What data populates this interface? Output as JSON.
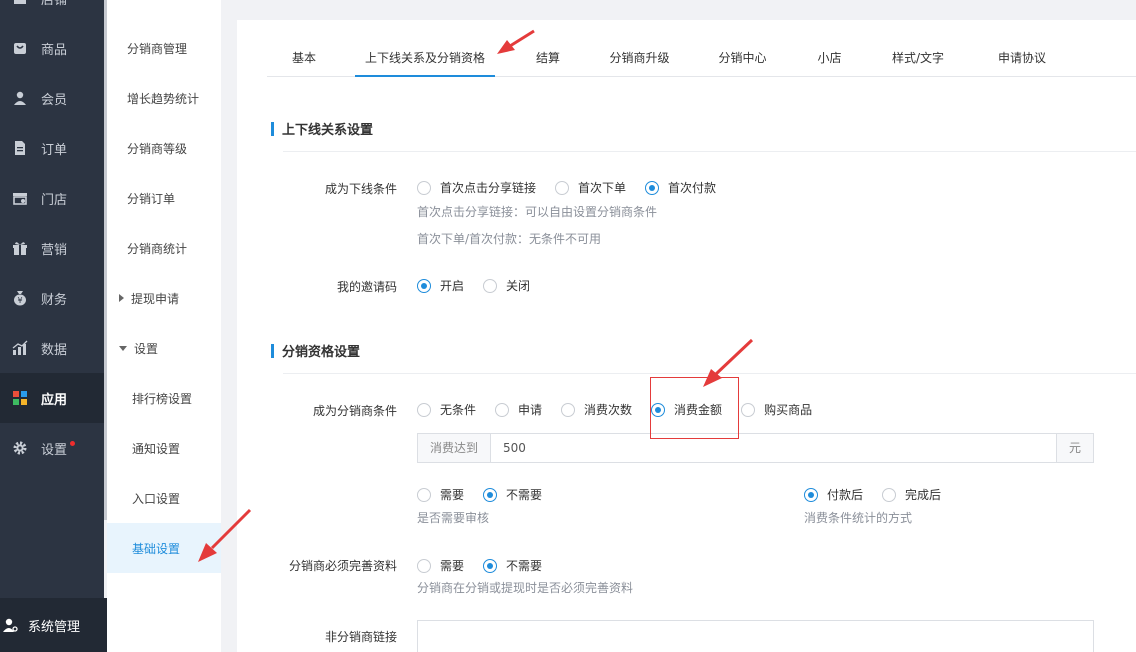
{
  "nav": {
    "items": [
      {
        "label": "店铺",
        "icon": "store-icon"
      },
      {
        "label": "商品",
        "icon": "goods-icon"
      },
      {
        "label": "会员",
        "icon": "member-icon"
      },
      {
        "label": "订单",
        "icon": "order-icon"
      },
      {
        "label": "门店",
        "icon": "shop-icon"
      },
      {
        "label": "营销",
        "icon": "gift-icon"
      },
      {
        "label": "财务",
        "icon": "finance-icon"
      },
      {
        "label": "数据",
        "icon": "chart-icon"
      },
      {
        "label": "应用",
        "icon": "apps-icon"
      },
      {
        "label": "设置",
        "icon": "gear-icon"
      }
    ],
    "bottom_label": "系统管理"
  },
  "subnav": {
    "items": [
      "分销商管理",
      "增长趋势统计",
      "分销商等级",
      "分销订单",
      "分销商统计"
    ],
    "group_withdraw": "提现申请",
    "group_settings": "设置",
    "settings_items": [
      "排行榜设置",
      "通知设置",
      "入口设置",
      "基础设置"
    ]
  },
  "tabs": [
    "基本",
    "上下线关系及分销资格",
    "结算",
    "分销商升级",
    "分销中心",
    "小店",
    "样式/文字",
    "申请协议"
  ],
  "section1": {
    "title": "上下线关系设置",
    "downline_label": "成为下线条件",
    "downline_options": [
      "首次点击分享链接",
      "首次下单",
      "首次付款"
    ],
    "hint1": "首次点击分享链接：可以自由设置分销商条件",
    "hint2": "首次下单/首次付款：无条件不可用",
    "invite_label": "我的邀请码",
    "invite_options": [
      "开启",
      "关闭"
    ]
  },
  "section2": {
    "title": "分销资格设置",
    "cond_label": "成为分销商条件",
    "cond_options": [
      "无条件",
      "申请",
      "消费次数",
      "消费金额",
      "购买商品"
    ],
    "amount_prefix": "消费达到",
    "amount_value": "500",
    "amount_suffix": "元",
    "review_options": [
      "需要",
      "不需要"
    ],
    "review_hint": "是否需要审核",
    "stat_options": [
      "付款后",
      "完成后"
    ],
    "stat_hint": "消费条件统计的方式",
    "profile_label": "分销商必须完善资料",
    "profile_options": [
      "需要",
      "不需要"
    ],
    "profile_hint": "分销商在分销或提现时是否必须完善资料",
    "link_label": "非分销商链接"
  },
  "colors": {
    "accent": "#1e8cdb",
    "nav_bg": "#2c3442",
    "annotation": "#e43b3b"
  }
}
